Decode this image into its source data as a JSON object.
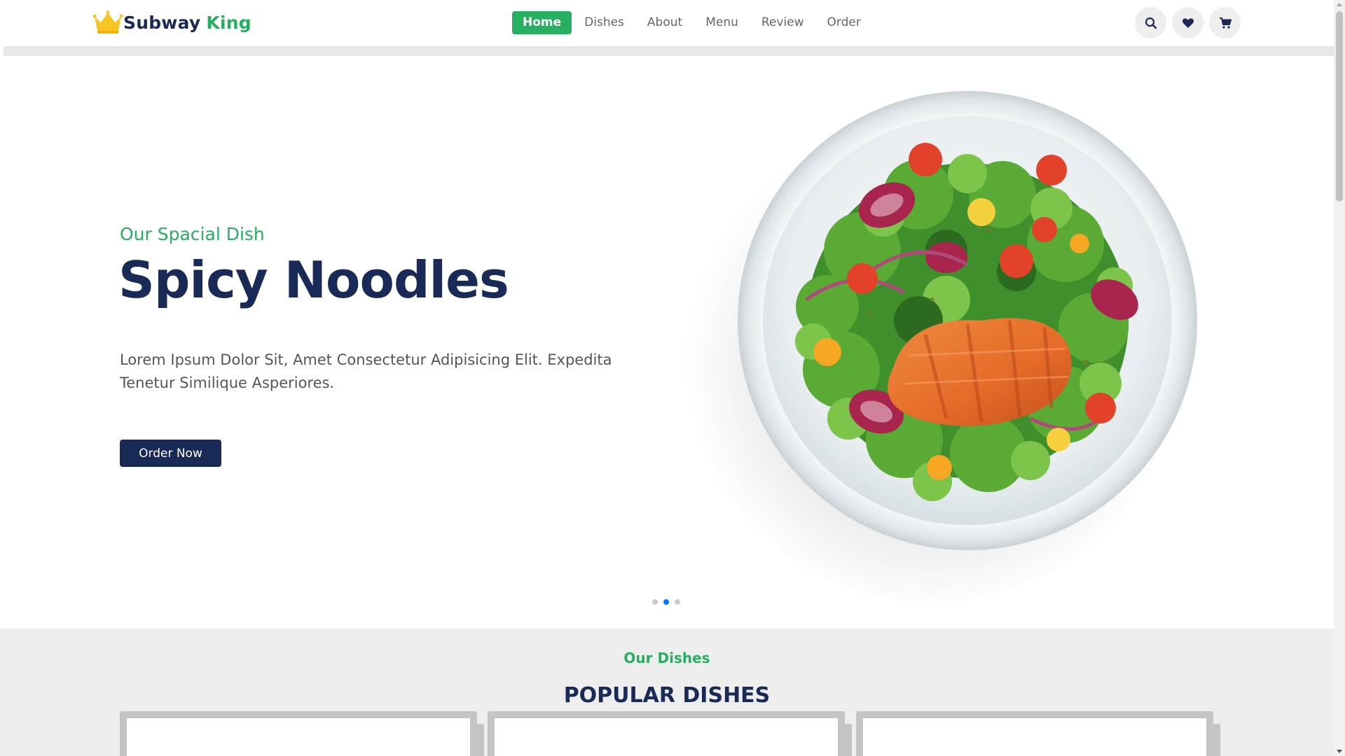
{
  "header": {
    "logo": {
      "word1": "Subway",
      "word2": "King",
      "icon": "crown-icon"
    },
    "nav": [
      {
        "label": "Home",
        "active": true
      },
      {
        "label": "Dishes",
        "active": false
      },
      {
        "label": "About",
        "active": false
      },
      {
        "label": "Menu",
        "active": false
      },
      {
        "label": "Review",
        "active": false
      },
      {
        "label": "Order",
        "active": false
      }
    ],
    "actions": [
      {
        "icon": "search-icon"
      },
      {
        "icon": "heart-icon"
      },
      {
        "icon": "shopping-cart-icon"
      }
    ]
  },
  "hero": {
    "subtitle": "Our Spacial Dish",
    "title": "Spicy Noodles",
    "description": "Lorem Ipsum Dolor Sit, Amet Consectetur Adipisicing Elit. Expedita Tenetur Similique Asperiores.",
    "button_label": "Order Now",
    "image": "salmon-salad-plate",
    "slides": {
      "count": 3,
      "active_index": 1
    }
  },
  "dishes": {
    "subtitle": "Our Dishes",
    "title": "POPULAR DISHES",
    "cards": [
      {},
      {},
      {}
    ]
  },
  "colors": {
    "brand_green": "#27ae60",
    "navy": "#192a56",
    "section_bg": "#eeeeee",
    "active_dot": "#007aff"
  }
}
